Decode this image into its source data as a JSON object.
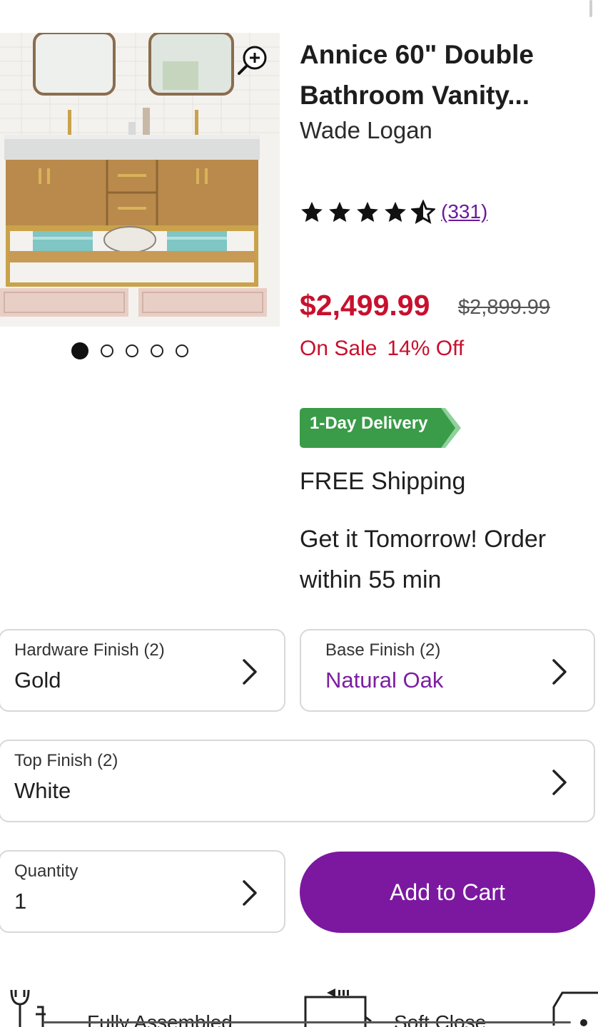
{
  "product": {
    "title": "Annice 60\" Double Bathroom Vanity...",
    "brand": "Wade Logan",
    "rating": 4.5,
    "review_count": "(331)",
    "price": "$2,499.99",
    "original_price": "$2,899.99",
    "sale_label": "On Sale",
    "discount_label": "14% Off",
    "image_count": 5,
    "active_image_index": 0
  },
  "delivery": {
    "badge": "1-Day Delivery",
    "shipping": "FREE Shipping",
    "eta": "Get it Tomorrow! Order within 55 min"
  },
  "options": {
    "hardware": {
      "label": "Hardware Finish (2)",
      "value": "Gold"
    },
    "base": {
      "label": "Base Finish (2)",
      "value": "Natural Oak"
    },
    "top": {
      "label": "Top Finish (2)",
      "value": "White"
    },
    "quantity": {
      "label": "Quantity",
      "value": "1"
    }
  },
  "actions": {
    "add_to_cart": "Add to Cart"
  },
  "features": [
    {
      "label": "Fully Assembled",
      "icon": "tools-icon"
    },
    {
      "label": "Soft Close",
      "icon": "drawer-icon"
    },
    {
      "label": "",
      "icon": "truck-icon"
    }
  ],
  "colors": {
    "accent_purple": "#7b189f",
    "sale_red": "#c8102e",
    "delivery_green": "#3a9b48"
  }
}
